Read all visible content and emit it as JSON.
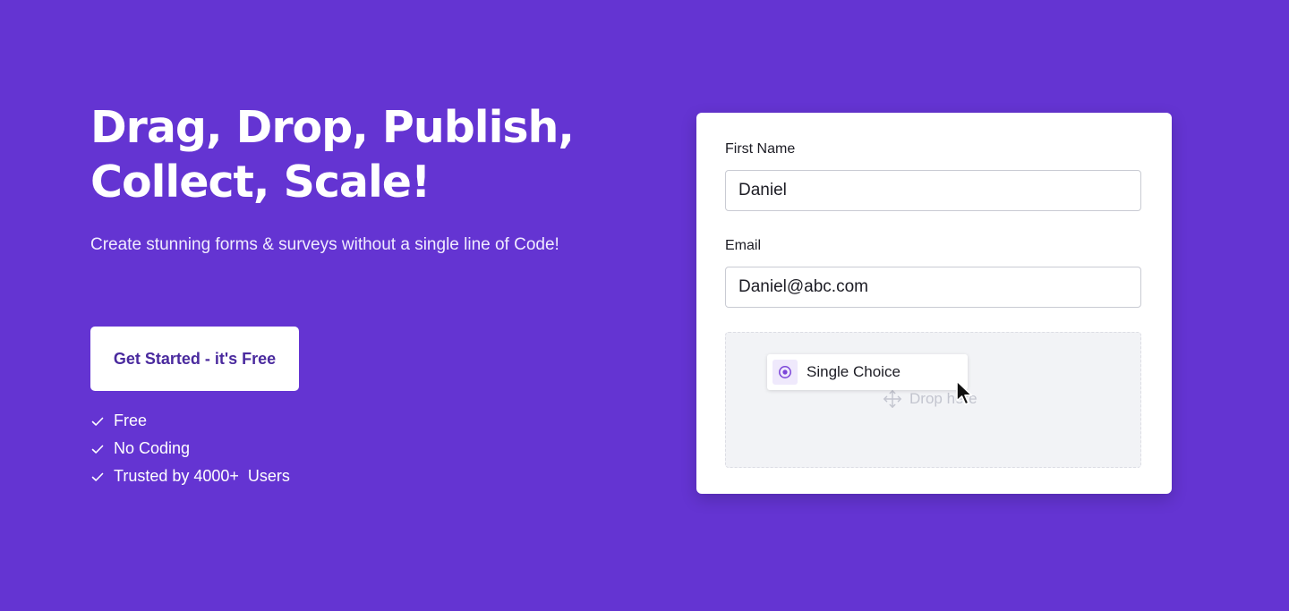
{
  "hero": {
    "headline_line1": "Drag, Drop, Publish,",
    "headline_line2": "Collect, Scale!",
    "subtitle": "Create stunning forms & surveys without a single line of Code!",
    "cta_label": "Get Started - it's Free",
    "features": [
      {
        "icon": "check-icon",
        "text": "Free"
      },
      {
        "icon": "check-icon",
        "text": "No Coding"
      },
      {
        "icon": "check-icon",
        "text": "Trusted by 4000+  Users"
      }
    ]
  },
  "form": {
    "first_name": {
      "label": "First Name",
      "value": "Daniel"
    },
    "email": {
      "label": "Email",
      "value": "Daniel@abc.com"
    },
    "drop_zone": {
      "hint": "Drop here",
      "dragged_item": {
        "icon": "radio-icon",
        "label": "Single Choice"
      },
      "cursor": "pointer-cursor-icon"
    }
  },
  "colors": {
    "background": "#6434d2",
    "cta_text": "#4a2a9e",
    "card": "#ffffff",
    "drop_zone": "#f2f3f6",
    "radio_accent": "#7b45d8"
  }
}
